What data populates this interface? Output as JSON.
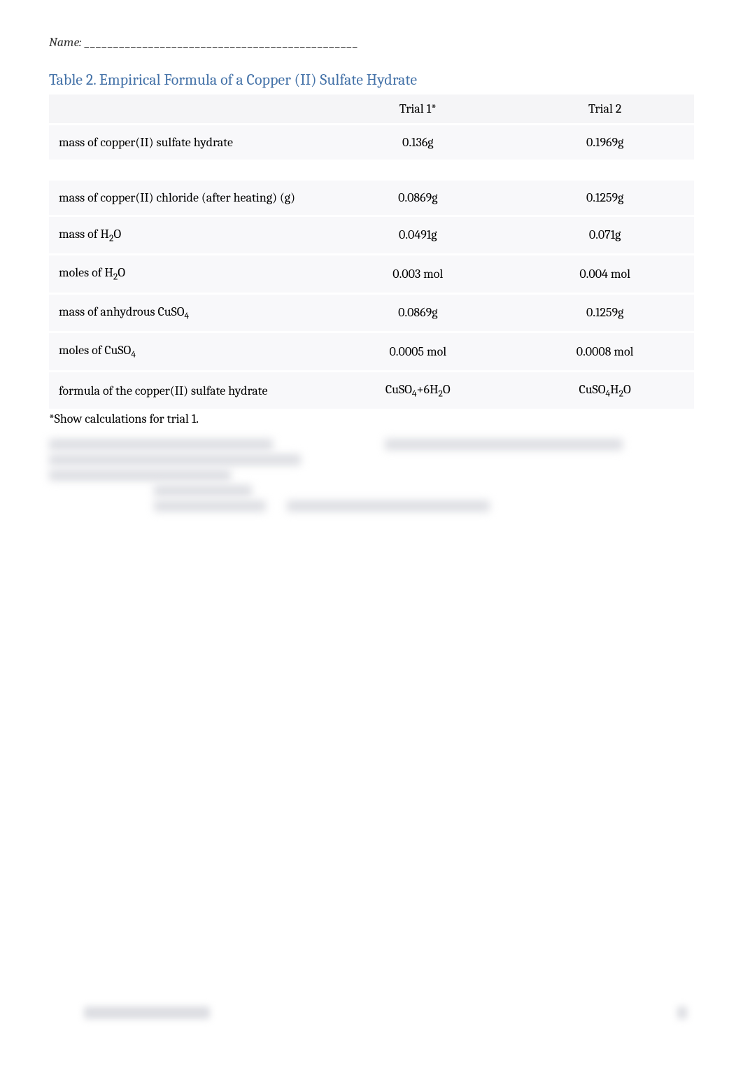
{
  "header": {
    "name_label": "Name: _______________________________________________"
  },
  "table": {
    "title": "Table 2. Empirical Formula of a Copper (II) Sulfate Hydrate",
    "columns": {
      "trial1": "Trial 1*",
      "trial2": "Trial 2"
    },
    "rows": {
      "row1": {
        "label": "mass of copper(II) sulfate hydrate",
        "trial1": "0.136g",
        "trial2": "0.1969g"
      },
      "row2": {
        "label_a": "mass of copper(II) chloride (after heating) (g)",
        "trial1": "0.0869g",
        "trial2": "0.1259g"
      },
      "row3": {
        "label_a": "mass of H",
        "label_b": "O",
        "sub": "2",
        "trial1": "0.0491g",
        "trial2": "0.071g"
      },
      "row4": {
        "label_a": "moles of H",
        "label_b": "O",
        "sub": "2",
        "trial1": "0.003 mol",
        "trial2": "0.004 mol"
      },
      "row5": {
        "label_a": "mass of anhydrous CuSO",
        "sub": "4",
        "trial1": "0.0869g",
        "trial2": "0.1259g"
      },
      "row6": {
        "label_a": "moles of CuSO",
        "sub": "4",
        "trial1": "0.0005 mol",
        "trial2": "0.0008 mol"
      },
      "row7": {
        "label": "formula of the copper(II) sulfate hydrate",
        "trial1_a": "CuSO",
        "trial1_sub1": "4",
        "trial1_b": "+6H",
        "trial1_sub2": "2",
        "trial1_c": "O",
        "trial2_a": "CuSO",
        "trial2_sub1": "4",
        "trial2_b": "H",
        "trial2_sub2": "2",
        "trial2_c": "O"
      }
    },
    "note": "*Show calculations for trial 1."
  }
}
